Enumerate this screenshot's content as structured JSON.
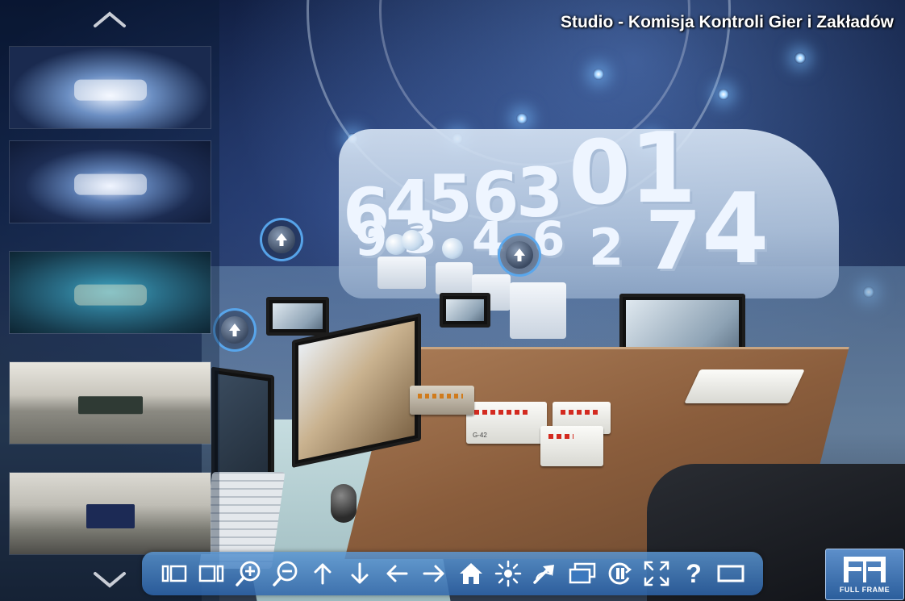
{
  "title": "Studio - Komisja Kontroli Gier i Zakładów",
  "scene": {
    "wall_digits": [
      "6",
      "4",
      "5",
      "6",
      "3",
      "0",
      "1",
      "9",
      "3",
      "4",
      "6",
      "2",
      "7",
      "4"
    ],
    "box_label": "G-42"
  },
  "thumbnails": [
    {
      "name": "studio-panorama-1"
    },
    {
      "name": "studio-panorama-2"
    },
    {
      "name": "control-room-panorama"
    },
    {
      "name": "office-panorama"
    },
    {
      "name": "monitoring-room-panorama"
    }
  ],
  "toolbar": {
    "buttons": [
      {
        "icon": "previous-panorama-icon"
      },
      {
        "icon": "next-panorama-icon"
      },
      {
        "icon": "zoom-in-icon"
      },
      {
        "icon": "zoom-out-icon"
      },
      {
        "icon": "arrow-up-icon"
      },
      {
        "icon": "arrow-down-icon"
      },
      {
        "icon": "arrow-left-icon"
      },
      {
        "icon": "arrow-right-icon"
      },
      {
        "icon": "home-icon"
      },
      {
        "icon": "hotspots-toggle-icon"
      },
      {
        "icon": "autorotate-icon"
      },
      {
        "icon": "thumbnails-toggle-icon"
      },
      {
        "icon": "gyro-icon"
      },
      {
        "icon": "fullscreen-icon"
      },
      {
        "icon": "help-icon"
      },
      {
        "icon": "window-mode-icon"
      }
    ],
    "help_glyph": "?"
  },
  "logo": {
    "text": "FULL FRAME"
  },
  "colors": {
    "toolbar": "#3b78be",
    "hotspot_ring": "#5aaaf0",
    "title_text": "#ffffff"
  }
}
